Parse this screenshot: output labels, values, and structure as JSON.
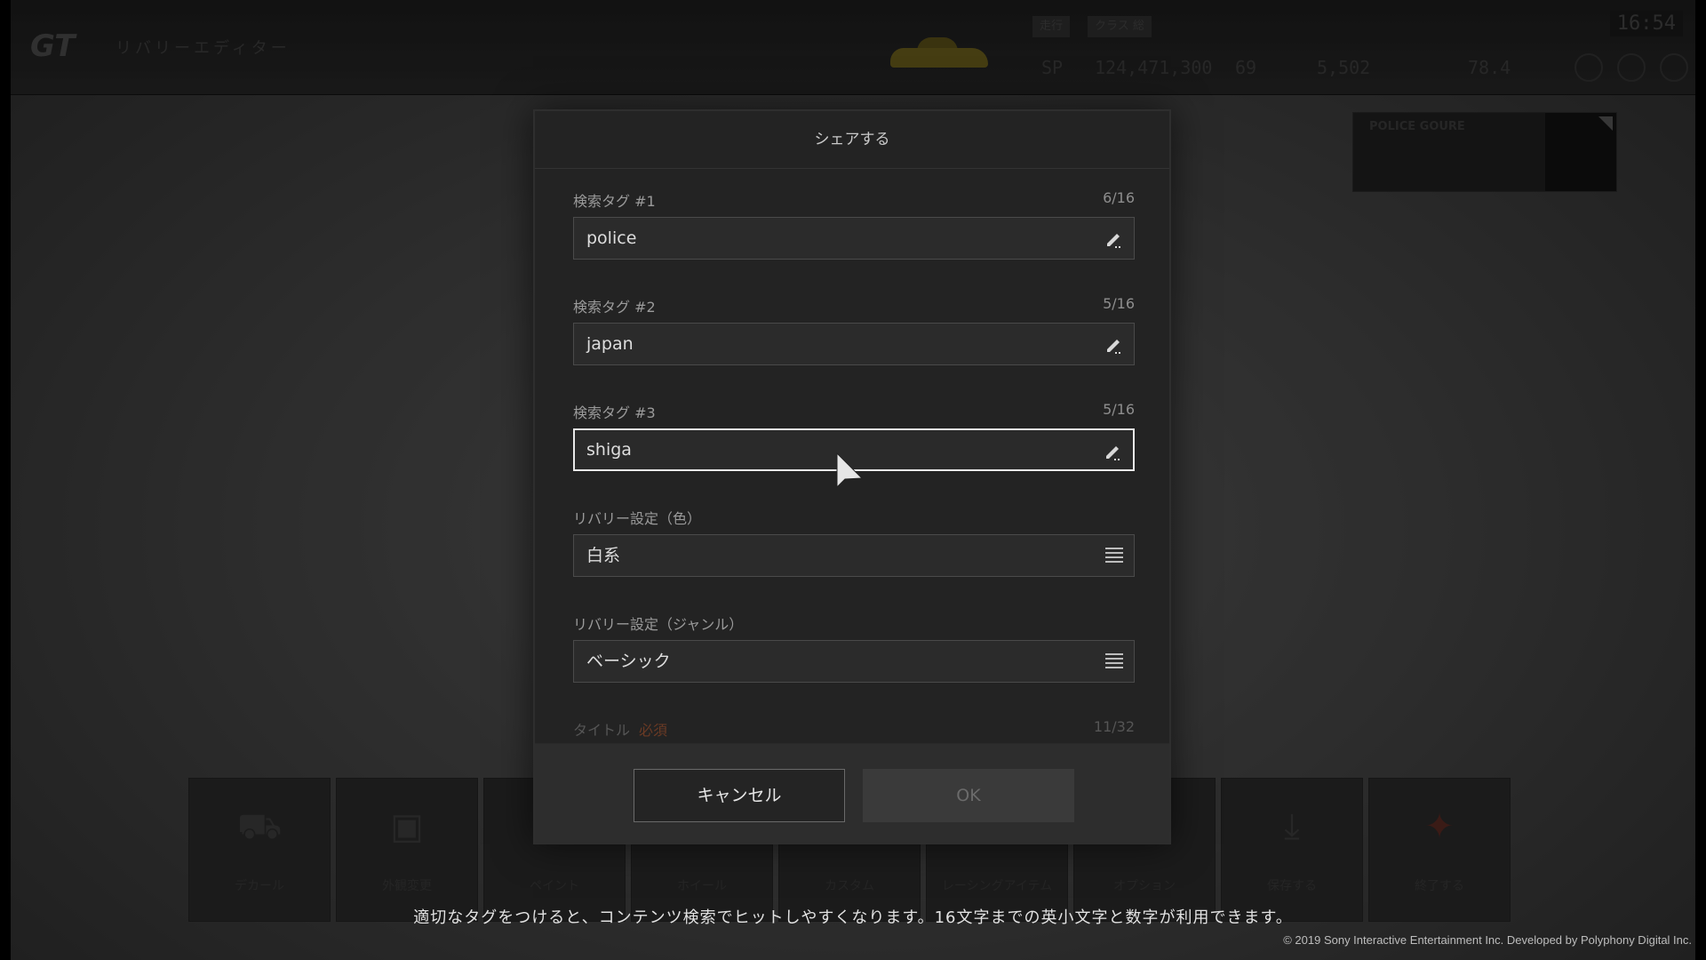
{
  "background": {
    "top_menu_label": "リバリーエディター",
    "top_tags": [
      "走行",
      "クラス 総"
    ],
    "stats": [
      "SP",
      "124,471,300",
      "69",
      "5,502",
      "78.4"
    ],
    "clock": "16:54",
    "livery_preview_title": "POLICE GOURE",
    "bottom_menu": [
      {
        "label": "デカール",
        "icon": "car-icon"
      },
      {
        "label": "外観変更",
        "icon": "car-edit-icon"
      },
      {
        "label": "ペイント",
        "icon": "paint-icon"
      },
      {
        "label": "ホイール",
        "icon": "wheel-icon"
      },
      {
        "label": "カスタム",
        "icon": "custom-icon"
      },
      {
        "label": "レーシングアイテム",
        "icon": "racing-icon"
      },
      {
        "label": "オプション",
        "icon": "option-icon"
      },
      {
        "label": "保存する",
        "icon": "download-icon"
      },
      {
        "label": "終了する",
        "icon": "exit-icon"
      }
    ]
  },
  "dialog": {
    "title": "シェアする",
    "fields": [
      {
        "label": "検索タグ #1",
        "count": "6/16",
        "value": "police",
        "type": "text"
      },
      {
        "label": "検索タグ #2",
        "count": "5/16",
        "value": "japan",
        "type": "text"
      },
      {
        "label": "検索タグ #3",
        "count": "5/16",
        "value": "shiga",
        "type": "text",
        "focused": true
      },
      {
        "label": "リバリー設定（色）",
        "value": "白系",
        "type": "select"
      },
      {
        "label": "リバリー設定（ジャンル）",
        "value": "ベーシック",
        "type": "select"
      }
    ],
    "partial_field": {
      "label": "タイトル",
      "required": "必須",
      "count": "11/32"
    },
    "cancel_label": "キャンセル",
    "ok_label": "OK"
  },
  "hint": "適切なタグをつけると、コンテンツ検索でヒットしやすくなります。16文字までの英小文字と数字が利用できます。",
  "copyright": "© 2019 Sony Interactive Entertainment Inc. Developed by Polyphony Digital Inc.",
  "colors": {
    "focus_border": "#e8e8e8",
    "dialog_bg": "#232323",
    "required": "#6a3a24"
  }
}
